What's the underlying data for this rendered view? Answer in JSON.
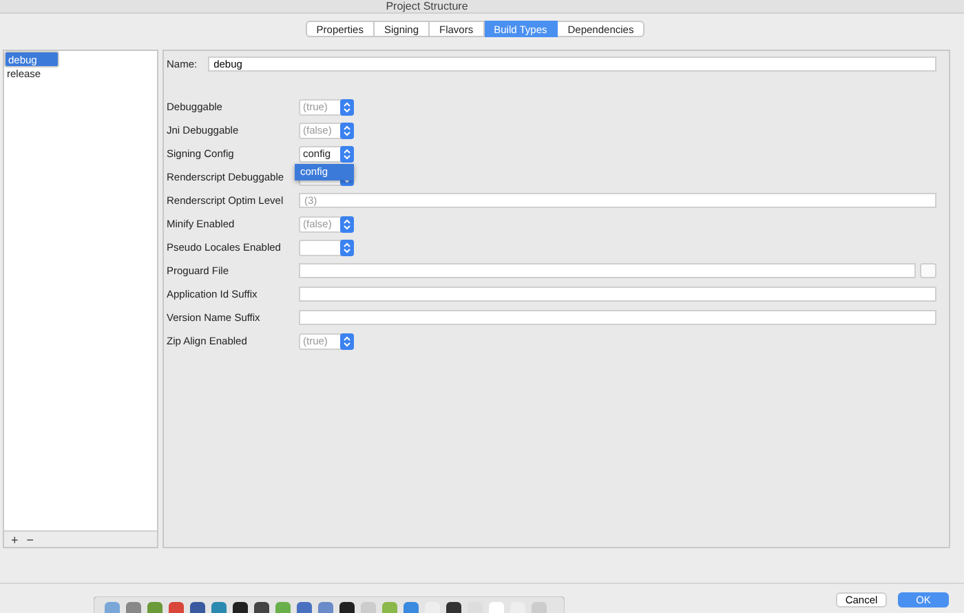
{
  "window": {
    "title": "Project Structure"
  },
  "tabs": [
    {
      "label": "Properties",
      "selected": false
    },
    {
      "label": "Signing",
      "selected": false
    },
    {
      "label": "Flavors",
      "selected": false
    },
    {
      "label": "Build Types",
      "selected": true
    },
    {
      "label": "Dependencies",
      "selected": false
    }
  ],
  "build_types": [
    {
      "label": "debug",
      "selected": true
    },
    {
      "label": "release",
      "selected": false
    }
  ],
  "list_buttons": [
    "+",
    "−"
  ],
  "name": {
    "label": "Name:",
    "value": "debug"
  },
  "fields": [
    {
      "kind": "select",
      "label": "Debuggable",
      "placeholder": "(true)"
    },
    {
      "kind": "select",
      "label": "Jni Debuggable",
      "placeholder": "(false)"
    },
    {
      "kind": "select",
      "label": "Signing Config",
      "value": "config",
      "options": [
        {
          "label": "config",
          "selected": true
        }
      ]
    },
    {
      "kind": "select",
      "label": "Renderscript Debuggable"
    },
    {
      "kind": "text",
      "label": "Renderscript Optim Level",
      "placeholder": "(3)"
    },
    {
      "kind": "select",
      "label": "Minify Enabled",
      "placeholder": "(false)"
    },
    {
      "kind": "select",
      "label": "Pseudo Locales Enabled"
    },
    {
      "kind": "file",
      "label": "Proguard File"
    },
    {
      "kind": "text",
      "label": "Application Id Suffix"
    },
    {
      "kind": "text",
      "label": "Version Name Suffix"
    },
    {
      "kind": "select",
      "label": "Zip Align Enabled",
      "placeholder": "(true)"
    }
  ],
  "buttons": [
    {
      "label": "Cancel",
      "kind": "normal"
    },
    {
      "label": "OK",
      "kind": "default"
    }
  ]
}
